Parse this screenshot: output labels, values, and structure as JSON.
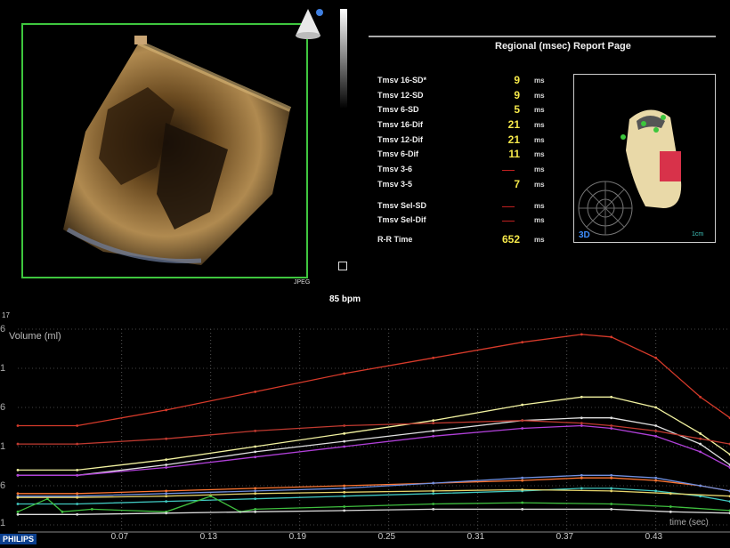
{
  "image_panel": {
    "badge": "JPEG",
    "heart_rate": "85 bpm"
  },
  "report": {
    "title": "Regional (msec) Report Page",
    "rows": [
      {
        "label": "Tmsv 16-SD*",
        "value": "9",
        "unit": "ms"
      },
      {
        "label": "Tmsv 12-SD",
        "value": "9",
        "unit": "ms"
      },
      {
        "label": "Tmsv 6-SD",
        "value": "5",
        "unit": "ms"
      },
      {
        "label": "Tmsv 16-Dif",
        "value": "21",
        "unit": "ms"
      },
      {
        "label": "Tmsv 12-Dif",
        "value": "21",
        "unit": "ms"
      },
      {
        "label": "Tmsv 6-Dif",
        "value": "11",
        "unit": "ms"
      },
      {
        "label": "Tmsv 3-6",
        "value": "",
        "unit": "ms"
      },
      {
        "label": "Tmsv 3-5",
        "value": "7",
        "unit": "ms"
      },
      {
        "label": "Tmsv Sel-SD",
        "value": "",
        "unit": "ms"
      },
      {
        "label": "Tmsv Sel-Dif",
        "value": "",
        "unit": "ms"
      },
      {
        "label": "R-R Time",
        "value": "652",
        "unit": "ms"
      }
    ]
  },
  "model_panel": {
    "label_3d": "3D",
    "scale_label": "1cm"
  },
  "plot": {
    "corner_label": "17",
    "y_tick_labels": [
      "6",
      "1",
      "6",
      "1",
      "6",
      "1"
    ],
    "footer": "PHILIPS"
  },
  "chart_data": {
    "type": "line",
    "title": "",
    "ylabel": "Volume (ml)",
    "xlabel": "time (sec)",
    "x_ticks": [
      0.07,
      0.13,
      0.19,
      0.25,
      0.31,
      0.37,
      0.43
    ],
    "xlim": [
      0,
      0.48
    ],
    "grid": true,
    "series": [
      {
        "color": "#d63a2a",
        "x": [
          0,
          0.04,
          0.1,
          0.16,
          0.22,
          0.28,
          0.34,
          0.38,
          0.4,
          0.43,
          0.46,
          0.48
        ],
        "y": [
          4.3,
          4.3,
          4.9,
          5.6,
          6.3,
          6.9,
          7.5,
          7.8,
          7.7,
          6.9,
          5.4,
          4.6
        ]
      },
      {
        "color": "#f2f2a0",
        "x": [
          0,
          0.04,
          0.1,
          0.16,
          0.22,
          0.28,
          0.34,
          0.38,
          0.4,
          0.43,
          0.46,
          0.48
        ],
        "y": [
          2.6,
          2.6,
          3.0,
          3.5,
          4.0,
          4.5,
          5.1,
          5.4,
          5.4,
          5.0,
          4.0,
          3.2
        ]
      },
      {
        "color": "#e0e0e0",
        "x": [
          0,
          0.04,
          0.1,
          0.16,
          0.22,
          0.28,
          0.34,
          0.38,
          0.4,
          0.43,
          0.46,
          0.48
        ],
        "y": [
          2.4,
          2.4,
          2.8,
          3.3,
          3.7,
          4.1,
          4.5,
          4.6,
          4.6,
          4.3,
          3.6,
          2.8
        ]
      },
      {
        "color": "#c03a30",
        "x": [
          0,
          0.04,
          0.1,
          0.16,
          0.22,
          0.28,
          0.34,
          0.38,
          0.4,
          0.43,
          0.46,
          0.48
        ],
        "y": [
          3.6,
          3.6,
          3.8,
          4.1,
          4.3,
          4.4,
          4.5,
          4.4,
          4.3,
          4.1,
          3.8,
          3.6
        ]
      },
      {
        "color": "#b040d8",
        "x": [
          0,
          0.04,
          0.1,
          0.16,
          0.22,
          0.28,
          0.34,
          0.38,
          0.4,
          0.43,
          0.46,
          0.48
        ],
        "y": [
          2.4,
          2.4,
          2.7,
          3.1,
          3.5,
          3.9,
          4.2,
          4.3,
          4.2,
          3.9,
          3.3,
          2.7
        ]
      },
      {
        "color": "#ff7733",
        "x": [
          0,
          0.04,
          0.1,
          0.16,
          0.22,
          0.28,
          0.34,
          0.38,
          0.4,
          0.43,
          0.46,
          0.48
        ],
        "y": [
          1.7,
          1.7,
          1.8,
          1.9,
          2.0,
          2.1,
          2.2,
          2.3,
          2.3,
          2.2,
          2.0,
          1.8
        ]
      },
      {
        "color": "#6f8fdf",
        "x": [
          0,
          0.04,
          0.1,
          0.16,
          0.22,
          0.28,
          0.34,
          0.38,
          0.4,
          0.43,
          0.46,
          0.48
        ],
        "y": [
          1.6,
          1.6,
          1.7,
          1.8,
          1.9,
          2.1,
          2.3,
          2.4,
          2.4,
          2.3,
          2.0,
          1.8
        ]
      },
      {
        "color": "#40c8c0",
        "x": [
          0,
          0.04,
          0.1,
          0.16,
          0.22,
          0.28,
          0.34,
          0.38,
          0.4,
          0.43,
          0.46,
          0.48
        ],
        "y": [
          1.3,
          1.3,
          1.4,
          1.5,
          1.6,
          1.7,
          1.8,
          1.9,
          1.9,
          1.8,
          1.6,
          1.4
        ]
      },
      {
        "color": "#3fbf3f",
        "x": [
          0,
          0.02,
          0.03,
          0.05,
          0.1,
          0.13,
          0.15,
          0.16,
          0.22,
          0.28,
          0.34,
          0.4,
          0.44,
          0.48
        ],
        "y": [
          1.0,
          1.5,
          1.0,
          1.1,
          1.0,
          1.6,
          1.0,
          1.1,
          1.2,
          1.3,
          1.35,
          1.3,
          1.2,
          1.05
        ]
      },
      {
        "color": "#e6d36a",
        "x": [
          0,
          0.04,
          0.1,
          0.16,
          0.22,
          0.28,
          0.34,
          0.4,
          0.44,
          0.48
        ],
        "y": [
          1.55,
          1.55,
          1.6,
          1.7,
          1.75,
          1.8,
          1.85,
          1.8,
          1.7,
          1.6
        ]
      },
      {
        "color": "#dddddd",
        "x": [
          0,
          0.04,
          0.1,
          0.16,
          0.22,
          0.28,
          0.34,
          0.4,
          0.44,
          0.48
        ],
        "y": [
          0.9,
          0.9,
          0.95,
          1.0,
          1.05,
          1.1,
          1.1,
          1.1,
          1.0,
          0.95
        ]
      }
    ]
  }
}
